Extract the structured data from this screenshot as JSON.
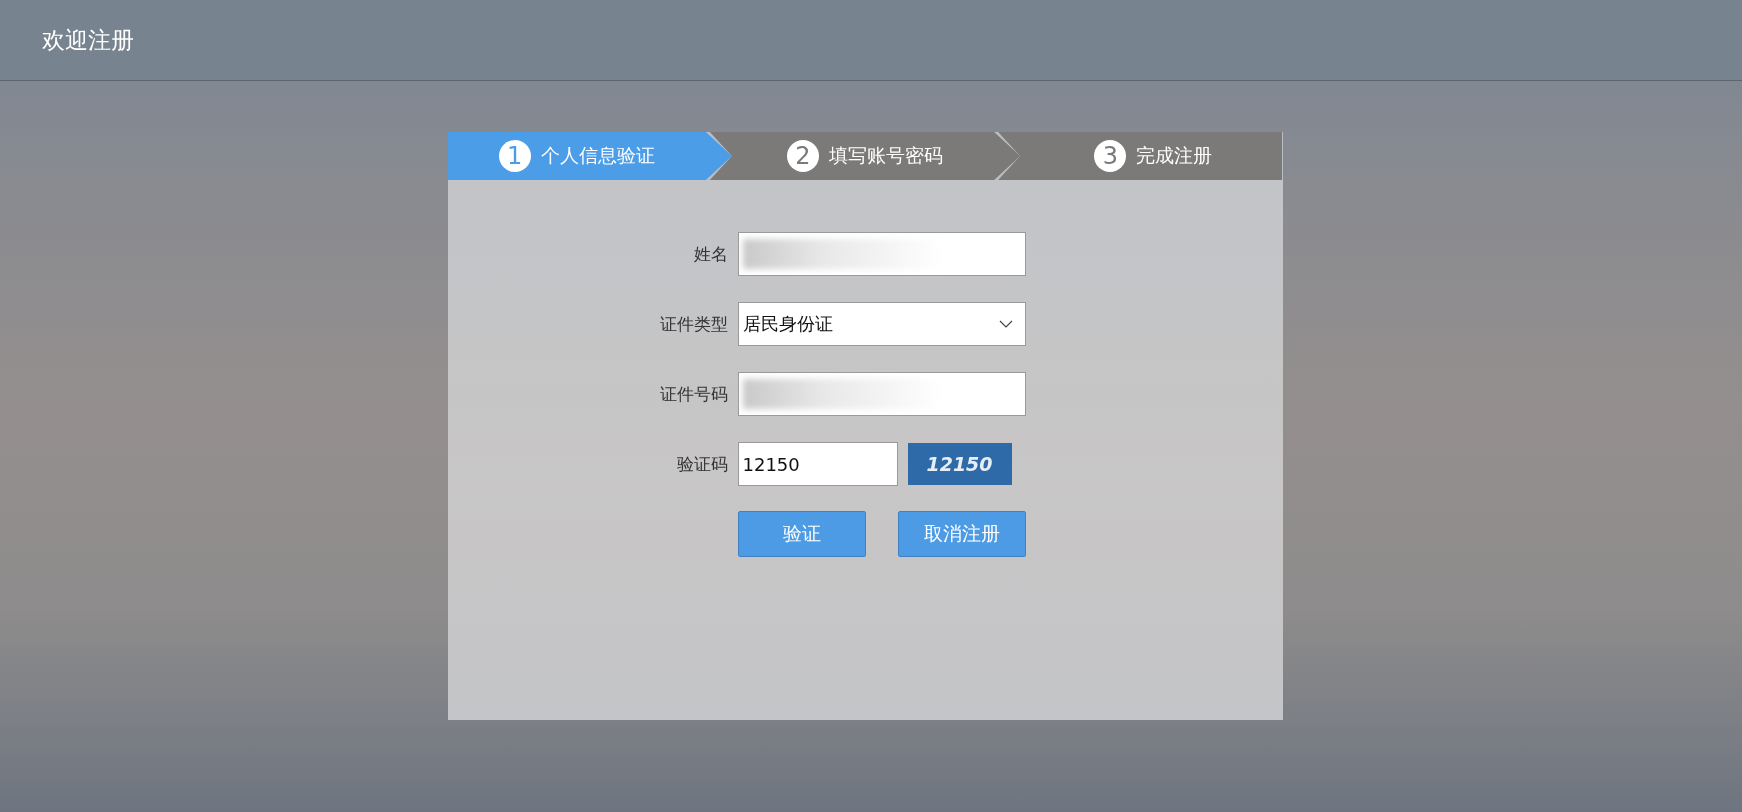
{
  "header": {
    "title": "欢迎注册"
  },
  "steps": [
    {
      "number": "1",
      "label": "个人信息验证",
      "selected": true
    },
    {
      "number": "2",
      "label": "填写账号密码",
      "selected": false
    },
    {
      "number": "3",
      "label": "完成注册",
      "selected": false
    }
  ],
  "form": {
    "fields": [
      {
        "kind": "text",
        "label": "姓名",
        "redacted": true
      },
      {
        "kind": "select",
        "label": "证件类型",
        "value": "居民身份证"
      },
      {
        "kind": "text",
        "label": "证件号码",
        "redacted": true
      },
      {
        "kind": "captcha",
        "label": "验证码",
        "value": "12150",
        "captcha": "12150"
      }
    ],
    "buttons": [
      "验证",
      "取消注册"
    ]
  }
}
